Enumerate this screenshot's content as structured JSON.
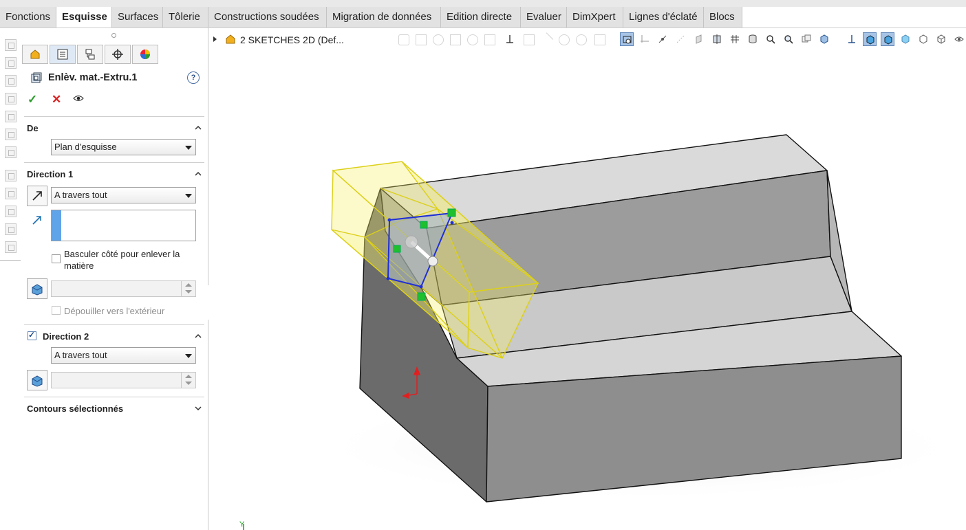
{
  "tabs": [
    {
      "label": "Fonctions",
      "active": false
    },
    {
      "label": "Esquisse",
      "active": true
    },
    {
      "label": "Surfaces",
      "active": false
    },
    {
      "label": "Tôlerie",
      "active": false
    },
    {
      "label": "Constructions soudées",
      "active": false
    },
    {
      "label": "Migration de données",
      "active": false
    },
    {
      "label": "Edition directe",
      "active": false
    },
    {
      "label": "Evaluer",
      "active": false
    },
    {
      "label": "DimXpert",
      "active": false
    },
    {
      "label": "Lignes d'éclaté",
      "active": false
    },
    {
      "label": "Blocs",
      "active": false
    }
  ],
  "property_manager": {
    "tab_icons": [
      "feature-manager-icon",
      "property-manager-icon",
      "configuration-manager-icon",
      "dimxpert-manager-icon",
      "display-manager-icon"
    ],
    "title": "Enlèv. mat.-Extru.1",
    "help_label": "?",
    "ok_label": "✓",
    "cancel_label": "✕",
    "from": {
      "title": "De",
      "value": "Plan d'esquisse"
    },
    "direction1": {
      "title": "Direction 1",
      "end_condition": "A travers tout",
      "flip_side_label": "Basculer côté pour enlever la matière",
      "flip_side_checked": false,
      "draft_outward_label": "Dépouiller vers l'extérieur",
      "draft_outward_checked": false
    },
    "direction2": {
      "title": "Direction 2",
      "checked": true,
      "end_condition": "A travers tout"
    },
    "selected_contours": {
      "title": "Contours sélectionnés"
    }
  },
  "graphics": {
    "tree_label": "2 SKETCHES 2D  (Def...",
    "triad_y_label": "Y",
    "hud_icons": [
      "zoom-to-fit-icon",
      "zoom-area-icon",
      "previous-view-icon",
      "section-view-icon",
      "view-orientation-icon",
      "display-style-icon",
      "hide-show-items-icon",
      "edit-appearance-icon",
      "apply-scene-icon",
      "view-settings-icon"
    ]
  },
  "colors": {
    "accent_blue": "#5fa3e8",
    "preview_yellow": "#f5ef6a",
    "sketch_blue": "#1f2fd6",
    "ok_green": "#2a9d2a",
    "cancel_red": "#dd2222"
  }
}
